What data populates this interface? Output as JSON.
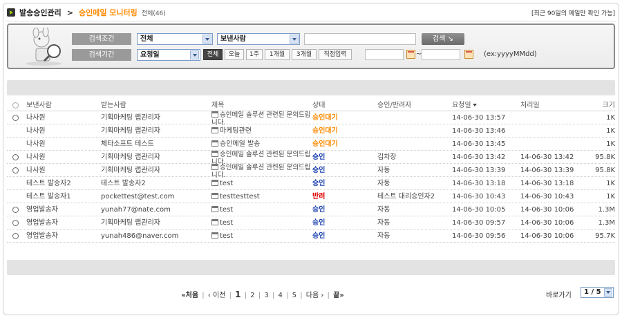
{
  "header": {
    "menu": "발송승인관리",
    "separator": ">",
    "current": "승인메일 모니터링",
    "count": "전체(46)",
    "notice": "[최근 90일의 메일만 확인 가능]"
  },
  "search": {
    "condition_label": "검색조건",
    "period_label": "검색기간",
    "scope_select": "전체",
    "field_select": "보낸사람",
    "keyword_value": "",
    "search_button": "검색",
    "date_type_select": "요청일",
    "period_buttons": [
      "전체",
      "오늘",
      "1주",
      "1개월",
      "3개월",
      "직접입력"
    ],
    "active_period": "전체",
    "date_from": "",
    "date_to": "",
    "tilde": "~",
    "format_hint": "(ex:yyyyMMdd)"
  },
  "table": {
    "columns": {
      "from": "보낸사람",
      "to": "받는사람",
      "subject": "제목",
      "status": "상태",
      "approver": "승인/반려자",
      "requested": "요청일",
      "processed": "처리일",
      "size": "크기"
    },
    "rows": [
      {
        "attach": true,
        "from": "나사원",
        "to": "기획마케팅 랩관리자",
        "subject": "승인메일 솔루션 관련된 문의드립니다.",
        "status": "승인대기",
        "status_type": "wait",
        "approver": "",
        "requested": "14-06-30 13:57",
        "processed": "",
        "size": "1K"
      },
      {
        "attach": false,
        "from": "나사원",
        "to": "기획마케팅 랩관리자",
        "subject": "마케팅관련",
        "status": "승인대기",
        "status_type": "wait",
        "approver": "",
        "requested": "14-06-30 13:46",
        "processed": "",
        "size": "1K"
      },
      {
        "attach": false,
        "from": "나사원",
        "to": "체타소프트 테스트",
        "subject": "승인메일 발송",
        "status": "승인대기",
        "status_type": "wait",
        "approver": "",
        "requested": "14-06-30 13:45",
        "processed": "",
        "size": "1K"
      },
      {
        "attach": true,
        "from": "나사원",
        "to": "기획마케팅 랩관리자",
        "subject": "승인메일 솔루션 관련된 문의드립니다.",
        "status": "승인",
        "status_type": "ok",
        "approver": "김차장",
        "requested": "14-06-30 13:42",
        "processed": "14-06-30 13:42",
        "size": "95.8K"
      },
      {
        "attach": true,
        "from": "나사원",
        "to": "기획마케팅 랩관리자",
        "subject": "승인메일 솔루션 관련된 문의드립니다.",
        "status": "승인",
        "status_type": "ok",
        "approver": "자동",
        "requested": "14-06-30 13:39",
        "processed": "14-06-30 13:39",
        "size": "95.8K"
      },
      {
        "attach": false,
        "from": "테스트 발송자2",
        "to": "테스트 발송자2",
        "subject": "test",
        "status": "승인",
        "status_type": "ok",
        "approver": "자동",
        "requested": "14-06-30 13:18",
        "processed": "14-06-30 13:18",
        "size": "1K"
      },
      {
        "attach": false,
        "from": "테스트 발송자1",
        "to": "pockettest@test.com",
        "subject": "testtesttest",
        "status": "반려",
        "status_type": "rej",
        "approver": "테스트 대리승인자2",
        "requested": "14-06-30 10:43",
        "processed": "14-06-30 10:43",
        "size": "1K"
      },
      {
        "attach": true,
        "from": "영업발송자",
        "to": "yunah77@nate.com",
        "subject": "test",
        "status": "승인",
        "status_type": "ok",
        "approver": "자동",
        "requested": "14-06-30 10:05",
        "processed": "14-06-30 10:06",
        "size": "1.3M"
      },
      {
        "attach": true,
        "from": "영업발송자",
        "to": "기획마케팅 랩관리자",
        "subject": "test",
        "status": "승인",
        "status_type": "ok",
        "approver": "자동",
        "requested": "14-06-30 09:57",
        "processed": "14-06-30 10:06",
        "size": "1.3M"
      },
      {
        "attach": true,
        "from": "영업발송자",
        "to": "yunah486@naver.com",
        "subject": "test",
        "status": "승인",
        "status_type": "ok",
        "approver": "자동",
        "requested": "14-06-30 09:56",
        "processed": "14-06-30 10:06",
        "size": "95.7K"
      }
    ]
  },
  "pager": {
    "first": "«처음",
    "prev": "‹ 이전",
    "pages": [
      "1",
      "2",
      "3",
      "4",
      "5"
    ],
    "current": "1",
    "next": "다음 ›",
    "last": "끝»",
    "goto_label": "바로가기",
    "goto_select": "1 / 5"
  }
}
